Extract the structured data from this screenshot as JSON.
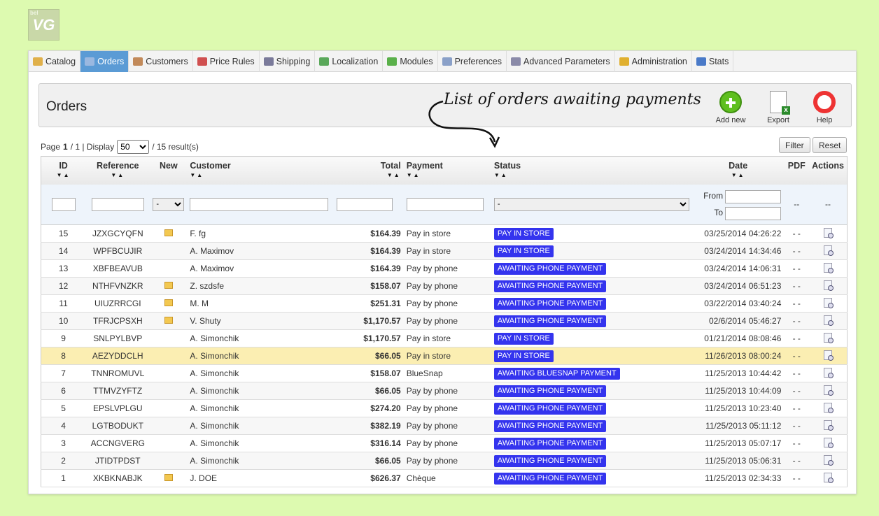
{
  "logo_text": "VG",
  "logo_small": "bel",
  "menu": [
    {
      "label": "Catalog",
      "icon": "folder-icon",
      "color": "#e0b04a"
    },
    {
      "label": "Orders",
      "icon": "cart-icon",
      "color": "#9ab8e0",
      "active": true
    },
    {
      "label": "Customers",
      "icon": "person-icon",
      "color": "#c28a5a"
    },
    {
      "label": "Price Rules",
      "icon": "price-tag-icon",
      "color": "#d05050"
    },
    {
      "label": "Shipping",
      "icon": "truck-icon",
      "color": "#7a7a9a"
    },
    {
      "label": "Localization",
      "icon": "globe-icon",
      "color": "#5aa85a"
    },
    {
      "label": "Modules",
      "icon": "puzzle-icon",
      "color": "#5ab04a"
    },
    {
      "label": "Preferences",
      "icon": "preferences-icon",
      "color": "#8aa0c8"
    },
    {
      "label": "Advanced Parameters",
      "icon": "wrench-icon",
      "color": "#8a8aa8"
    },
    {
      "label": "Administration",
      "icon": "key-icon",
      "color": "#e0b030"
    },
    {
      "label": "Stats",
      "icon": "chart-icon",
      "color": "#4a7ac8"
    }
  ],
  "toolbar": {
    "title": "Orders",
    "annotation": "List of orders awaiting payments",
    "add_new": "Add new",
    "export": "Export",
    "help": "Help"
  },
  "pager": {
    "page_label": "Page",
    "page_current": "1",
    "page_total": "/ 1 | Display",
    "per_page": "50",
    "results": "/ 15 result(s)"
  },
  "buttons": {
    "filter": "Filter",
    "reset": "Reset"
  },
  "columns": {
    "id": "ID",
    "reference": "Reference",
    "new": "New",
    "customer": "Customer",
    "total": "Total",
    "payment": "Payment",
    "status": "Status",
    "date": "Date",
    "pdf": "PDF",
    "actions": "Actions"
  },
  "filters": {
    "new_default": "-",
    "status_default": "-",
    "from": "From",
    "to": "To",
    "pdf": "--",
    "actions": "--"
  },
  "orders": [
    {
      "id": "15",
      "ref": "JZXGCYQFN",
      "new": true,
      "customer": "F. fg",
      "total": "$164.39",
      "payment": "Pay in store",
      "status": "PAY IN STORE",
      "date": "03/25/2014 04:26:22",
      "pdf": "- -"
    },
    {
      "id": "14",
      "ref": "WPFBCUJIR",
      "new": false,
      "customer": "A. Maximov",
      "total": "$164.39",
      "payment": "Pay in store",
      "status": "PAY IN STORE",
      "date": "03/24/2014 14:34:46",
      "pdf": "- -"
    },
    {
      "id": "13",
      "ref": "XBFBEAVUB",
      "new": false,
      "customer": "A. Maximov",
      "total": "$164.39",
      "payment": "Pay by phone",
      "status": "AWAITING PHONE PAYMENT",
      "date": "03/24/2014 14:06:31",
      "pdf": "- -"
    },
    {
      "id": "12",
      "ref": "NTHFVNZKR",
      "new": true,
      "customer": "Z. szdsfe",
      "total": "$158.07",
      "payment": "Pay by phone",
      "status": "AWAITING PHONE PAYMENT",
      "date": "03/24/2014 06:51:23",
      "pdf": "- -"
    },
    {
      "id": "11",
      "ref": "UIUZRRCGI",
      "new": true,
      "customer": "M. M",
      "total": "$251.31",
      "payment": "Pay by phone",
      "status": "AWAITING PHONE PAYMENT",
      "date": "03/22/2014 03:40:24",
      "pdf": "- -"
    },
    {
      "id": "10",
      "ref": "TFRJCPSXH",
      "new": true,
      "customer": "V. Shuty",
      "total": "$1,170.57",
      "payment": "Pay by phone",
      "status": "AWAITING PHONE PAYMENT",
      "date": "02/6/2014 05:46:27",
      "pdf": "- -"
    },
    {
      "id": "9",
      "ref": "SNLPYLBVP",
      "new": false,
      "customer": "A. Simonchik",
      "total": "$1,170.57",
      "payment": "Pay in store",
      "status": "PAY IN STORE",
      "date": "01/21/2014 08:08:46",
      "pdf": "- -"
    },
    {
      "id": "8",
      "ref": "AEZYDDCLH",
      "new": false,
      "customer": "A. Simonchik",
      "total": "$66.05",
      "payment": "Pay in store",
      "status": "PAY IN STORE",
      "date": "11/26/2013 08:00:24",
      "pdf": "- -",
      "highlight": true
    },
    {
      "id": "7",
      "ref": "TNNROMUVL",
      "new": false,
      "customer": "A. Simonchik",
      "total": "$158.07",
      "payment": "BlueSnap",
      "status": "AWAITING BLUESNAP PAYMENT",
      "date": "11/25/2013 10:44:42",
      "pdf": "- -"
    },
    {
      "id": "6",
      "ref": "TTMVZYFTZ",
      "new": false,
      "customer": "A. Simonchik",
      "total": "$66.05",
      "payment": "Pay by phone",
      "status": "AWAITING PHONE PAYMENT",
      "date": "11/25/2013 10:44:09",
      "pdf": "- -"
    },
    {
      "id": "5",
      "ref": "EPSLVPLGU",
      "new": false,
      "customer": "A. Simonchik",
      "total": "$274.20",
      "payment": "Pay by phone",
      "status": "AWAITING PHONE PAYMENT",
      "date": "11/25/2013 10:23:40",
      "pdf": "- -"
    },
    {
      "id": "4",
      "ref": "LGTBODUKT",
      "new": false,
      "customer": "A. Simonchik",
      "total": "$382.19",
      "payment": "Pay by phone",
      "status": "AWAITING PHONE PAYMENT",
      "date": "11/25/2013 05:11:12",
      "pdf": "- -"
    },
    {
      "id": "3",
      "ref": "ACCNGVERG",
      "new": false,
      "customer": "A. Simonchik",
      "total": "$316.14",
      "payment": "Pay by phone",
      "status": "AWAITING PHONE PAYMENT",
      "date": "11/25/2013 05:07:17",
      "pdf": "- -"
    },
    {
      "id": "2",
      "ref": "JTIDTPDST",
      "new": false,
      "customer": "A. Simonchik",
      "total": "$66.05",
      "payment": "Pay by phone",
      "status": "AWAITING PHONE PAYMENT",
      "date": "11/25/2013 05:06:31",
      "pdf": "- -"
    },
    {
      "id": "1",
      "ref": "XKBKNABJK",
      "new": true,
      "customer": "J. DOE",
      "total": "$626.37",
      "payment": "Chèque",
      "status": "AWAITING PHONE PAYMENT",
      "date": "11/25/2013 02:34:33",
      "pdf": "- -"
    }
  ],
  "colors": {
    "status_badge": "#3434ee",
    "active_tab": "#5b9bd5",
    "highlight_row": "#fbeeb2",
    "page_bg": "#ddfab0"
  }
}
